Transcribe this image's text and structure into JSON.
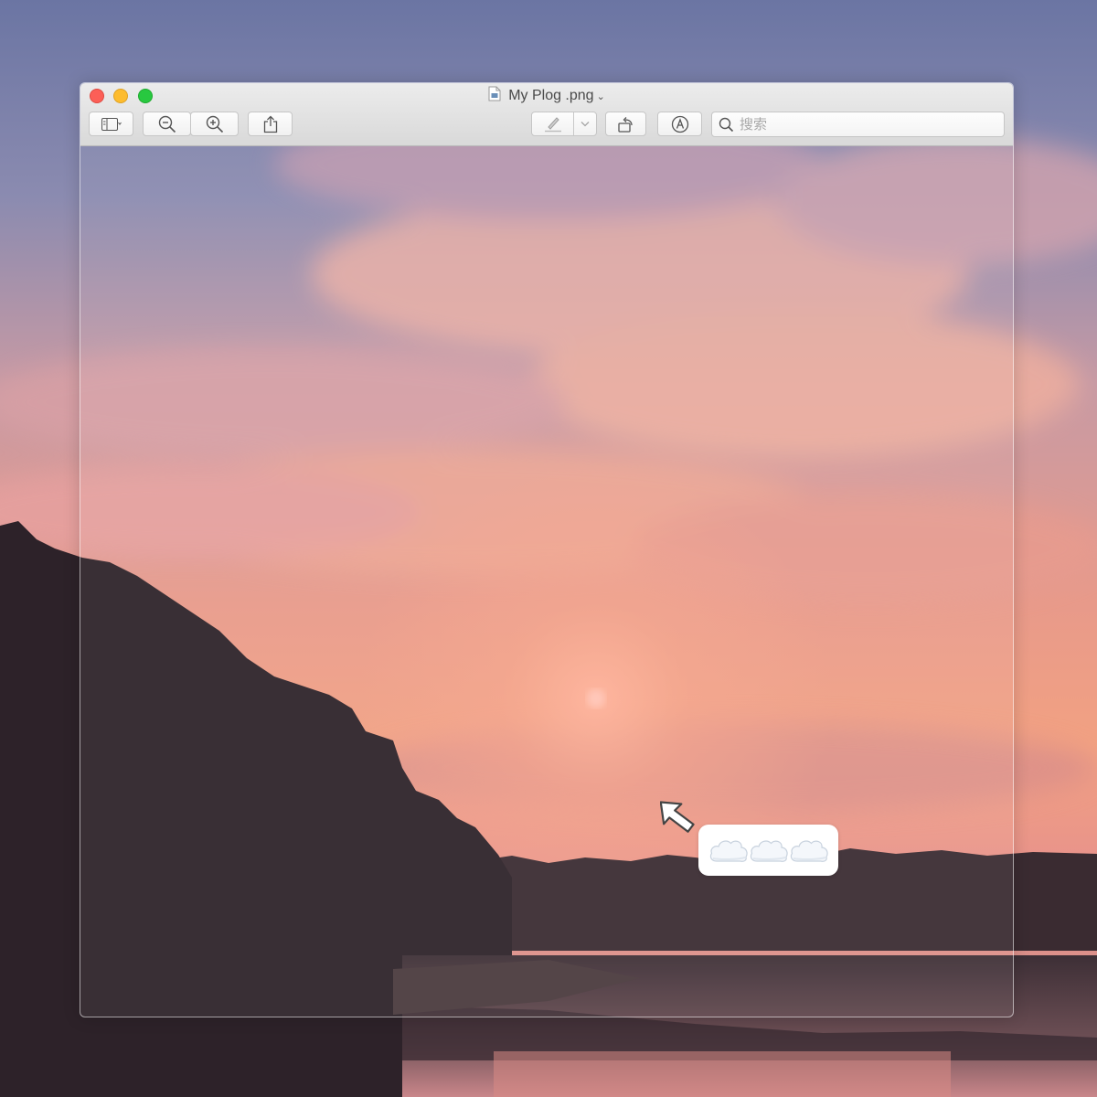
{
  "window": {
    "title": "My Plog .png",
    "title_chevron": "⌄"
  },
  "toolbar": {
    "sidebar_button": "sidebar-icon",
    "zoom_out_button": "zoom-out-icon",
    "zoom_in_button": "zoom-in-icon",
    "share_button": "share-icon",
    "markup_pen_button": "pen-icon",
    "rotate_button": "rotate-icon",
    "annotate_button": "markup-icon"
  },
  "search": {
    "placeholder": "搜索",
    "value": ""
  },
  "cloud_bubble": {
    "text": "☁️☁️☁️",
    "icon": "cloud-icon",
    "count": 3
  },
  "colors": {
    "close": "#fc5f57",
    "minimize": "#fdbc2e",
    "maximize": "#28c840",
    "sky_top": "#6f78a8",
    "sky_glow": "#f0a07f"
  }
}
